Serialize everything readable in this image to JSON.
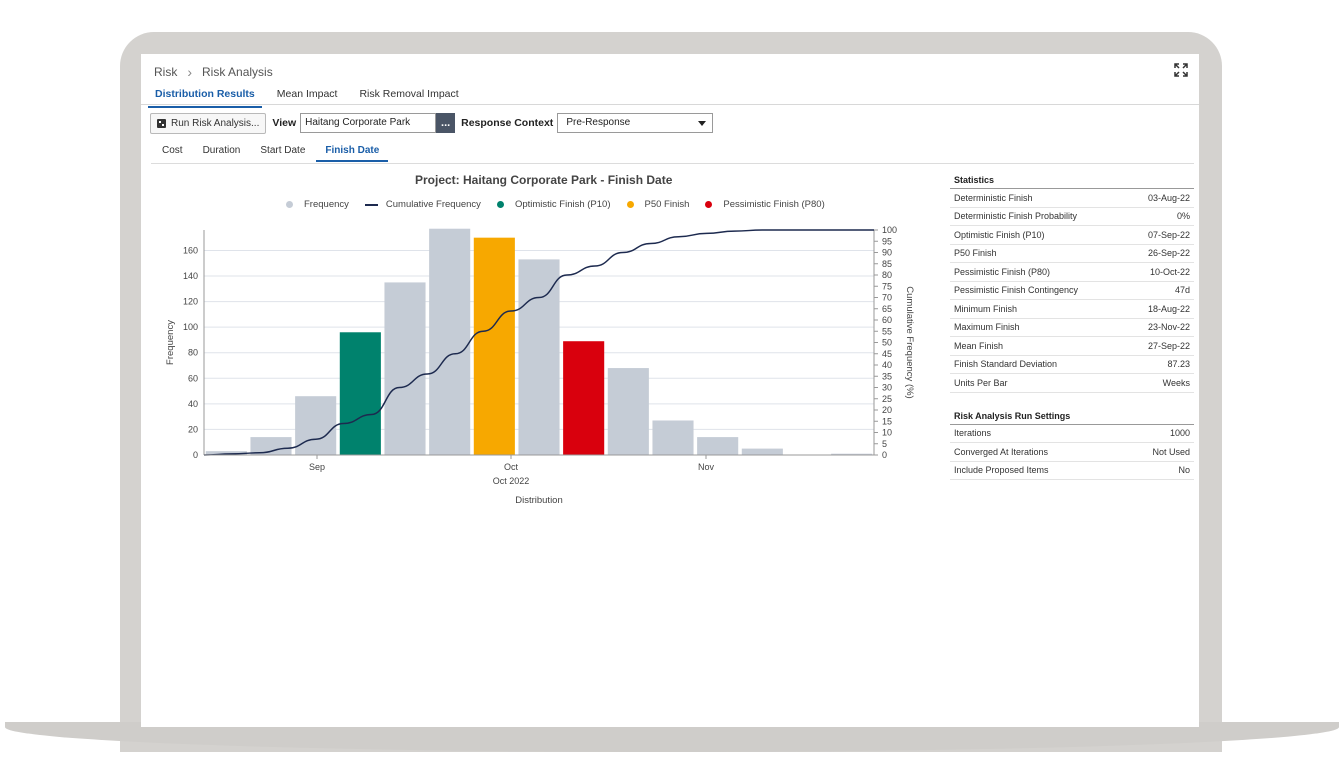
{
  "breadcrumb": {
    "root": "Risk",
    "current": "Risk Analysis"
  },
  "tabs": [
    "Distribution Results",
    "Mean Impact",
    "Risk Removal Impact"
  ],
  "toolbar": {
    "run_button": "Run Risk Analysis...",
    "view_label": "View",
    "view_value": "Haitang Corporate Park",
    "dots": "...",
    "context_label": "Response Context",
    "context_value": "Pre-Response"
  },
  "sub_tabs": [
    "Cost",
    "Duration",
    "Start Date",
    "Finish Date"
  ],
  "colors": {
    "frequency": "#c5ccd6",
    "optimistic": "#00826d",
    "p50": "#f7a800",
    "pessimistic": "#d9000d",
    "cumulative": "#1d2a4f",
    "accent": "#1a5ea8"
  },
  "chart_data": {
    "type": "bar",
    "title": "Project: Haitang Corporate Park - Finish Date",
    "xlabel": "Distribution",
    "ylabel": "Frequency",
    "y2label": "Cumulative Frequency (%)",
    "x_ticks": [
      "Sep",
      "Oct",
      "Nov"
    ],
    "x_sublabel": "Oct 2022",
    "ylim": [
      0,
      176
    ],
    "y_ticks": [
      0,
      20,
      40,
      60,
      80,
      100,
      120,
      140,
      160
    ],
    "y2lim": [
      0,
      100
    ],
    "y2_ticks": [
      0,
      5,
      10,
      15,
      20,
      25,
      30,
      35,
      40,
      45,
      50,
      55,
      60,
      65,
      70,
      75,
      80,
      85,
      90,
      95,
      100
    ],
    "legend": [
      "Frequency",
      "Cumulative Frequency",
      "Optimistic Finish (P10)",
      "P50 Finish",
      "Pessimistic Finish (P80)"
    ],
    "bars": [
      {
        "value": 3,
        "kind": "frequency"
      },
      {
        "value": 14,
        "kind": "frequency"
      },
      {
        "value": 46,
        "kind": "frequency"
      },
      {
        "value": 96,
        "kind": "optimistic"
      },
      {
        "value": 135,
        "kind": "frequency"
      },
      {
        "value": 177,
        "kind": "frequency"
      },
      {
        "value": 170,
        "kind": "p50"
      },
      {
        "value": 153,
        "kind": "frequency"
      },
      {
        "value": 89,
        "kind": "pessimistic"
      },
      {
        "value": 68,
        "kind": "frequency"
      },
      {
        "value": 27,
        "kind": "frequency"
      },
      {
        "value": 14,
        "kind": "frequency"
      },
      {
        "value": 5,
        "kind": "frequency"
      },
      {
        "value": 0,
        "kind": "frequency"
      },
      {
        "value": 1,
        "kind": "frequency"
      }
    ],
    "cumulative": [
      0,
      0.5,
      1,
      3,
      7,
      14,
      18,
      30,
      36,
      45,
      55,
      64,
      70,
      80,
      84,
      90,
      94,
      97,
      98.5,
      99.5,
      100,
      100,
      100,
      100,
      100
    ]
  },
  "statistics": {
    "title": "Statistics",
    "rows": [
      {
        "label": "Deterministic Finish",
        "value": "03-Aug-22"
      },
      {
        "label": "Deterministic Finish Probability",
        "value": "0%"
      },
      {
        "label": "Optimistic Finish (P10)",
        "value": "07-Sep-22"
      },
      {
        "label": "P50 Finish",
        "value": "26-Sep-22"
      },
      {
        "label": "Pessimistic Finish (P80)",
        "value": "10-Oct-22"
      },
      {
        "label": "Pessimistic Finish Contingency",
        "value": "47d"
      },
      {
        "label": "Minimum Finish",
        "value": "18-Aug-22"
      },
      {
        "label": "Maximum Finish",
        "value": "23-Nov-22"
      },
      {
        "label": "Mean Finish",
        "value": "27-Sep-22"
      },
      {
        "label": "Finish Standard Deviation",
        "value": "87.23"
      },
      {
        "label": "Units Per Bar",
        "value": "Weeks"
      }
    ]
  },
  "run_settings": {
    "title": "Risk Analysis Run Settings",
    "rows": [
      {
        "label": "Iterations",
        "value": "1000"
      },
      {
        "label": "Converged At Iterations",
        "value": "Not Used"
      },
      {
        "label": "Include Proposed Items",
        "value": "No"
      }
    ]
  }
}
